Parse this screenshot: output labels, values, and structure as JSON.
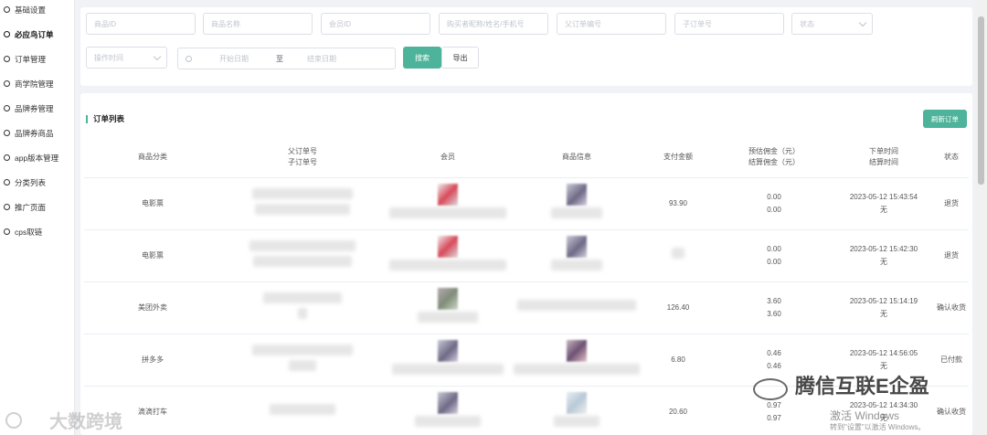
{
  "sidebar": {
    "items": [
      {
        "label": "基础设置"
      },
      {
        "label": "必应鸟订单"
      },
      {
        "label": "订单管理"
      },
      {
        "label": "商学院管理"
      },
      {
        "label": "品牌券管理"
      },
      {
        "label": "品牌券商品"
      },
      {
        "label": "app版本管理"
      },
      {
        "label": "分类列表"
      },
      {
        "label": "推广页面"
      },
      {
        "label": "cps取链"
      }
    ]
  },
  "filters": {
    "product_id": "商品ID",
    "product_name": "商品名称",
    "member_id": "会员ID",
    "buyer": "购买者昵称/姓名/手机号",
    "parent_order_no": "父订单编号",
    "child_order_no": "子订单号",
    "status": "状态",
    "operation_time": "操作时间",
    "start_date": "开始日期",
    "date_sep": "至",
    "end_date": "结束日期",
    "search_label": "搜索",
    "export_label": "导出"
  },
  "list": {
    "title": "订单列表",
    "refresh_label": "刷新订单",
    "headers": {
      "category": "商品分类",
      "parent_order": "父订单号",
      "child_order": "子订单号",
      "member": "会员",
      "product_info": "商品信息",
      "pay_amount": "支付金额",
      "est_commission": "预估佣金（元）",
      "settle_commission": "结算佣金（元）",
      "order_time": "下单时间",
      "settle_time": "结算时间",
      "status": "状态"
    },
    "rows": [
      {
        "category": "电影票",
        "amount": "93.90",
        "est": "0.00",
        "settle": "0.00",
        "order_time": "2023-05-12 15:43:54",
        "settle_time": "无",
        "status": "退货"
      },
      {
        "category": "电影票",
        "amount": "",
        "est": "0.00",
        "settle": "0.00",
        "order_time": "2023-05-12 15:42:30",
        "settle_time": "无",
        "status": "退货"
      },
      {
        "category": "美团外卖",
        "amount": "126.40",
        "est": "3.60",
        "settle": "3.60",
        "order_time": "2023-05-12 15:14:19",
        "settle_time": "无",
        "status": "确认收货"
      },
      {
        "category": "拼多多",
        "amount": "6.80",
        "est": "0.46",
        "settle": "0.46",
        "order_time": "2023-05-12 14:56:05",
        "settle_time": "无",
        "status": "已付款"
      },
      {
        "category": "滴滴打车",
        "amount": "20.60",
        "est": "0.97",
        "settle": "0.97",
        "order_time": "2023-05-12 14:34:30",
        "settle_time": "无",
        "status": "确认收货"
      }
    ]
  },
  "watermarks": {
    "left": "大数跨境",
    "right": "腾信互联E企盈",
    "activate": "激活 Windows",
    "activate_hint": "转到\"设置\"以激活 Windows。"
  },
  "colors": {
    "accent": "#4db39a"
  }
}
